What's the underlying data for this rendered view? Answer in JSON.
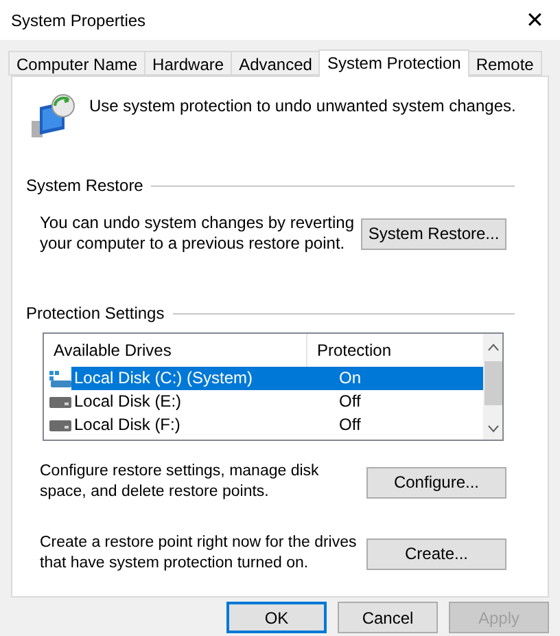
{
  "window": {
    "title": "System Properties",
    "close": "✕"
  },
  "tabs": [
    {
      "label": "Computer Name",
      "selected": false
    },
    {
      "label": "Hardware",
      "selected": false
    },
    {
      "label": "Advanced",
      "selected": false
    },
    {
      "label": "System Protection",
      "selected": true
    },
    {
      "label": "Remote",
      "selected": false
    }
  ],
  "intro": "Use system protection to undo unwanted system changes.",
  "system_restore": {
    "heading": "System Restore",
    "text": "You can undo system changes by reverting your computer to a previous restore point.",
    "button": "System Restore..."
  },
  "protection_settings": {
    "heading": "Protection Settings",
    "columns": [
      "Available Drives",
      "Protection"
    ],
    "drives": [
      {
        "name": "Local Disk (C:) (System)",
        "protection": "On",
        "kind": "system",
        "selected": true
      },
      {
        "name": "Local Disk (E:)",
        "protection": "Off",
        "kind": "disk",
        "selected": false
      },
      {
        "name": "Local Disk (F:)",
        "protection": "Off",
        "kind": "disk",
        "selected": false
      }
    ],
    "actions": [
      {
        "text": "Configure restore settings, manage disk space, and delete restore points.",
        "button": "Configure..."
      },
      {
        "text": "Create a restore point right now for the drives that have system protection turned on.",
        "button": "Create..."
      }
    ]
  },
  "buttons": [
    {
      "label": "OK",
      "default": true,
      "disabled": false
    },
    {
      "label": "Cancel",
      "default": false,
      "disabled": false
    },
    {
      "label": "Apply",
      "default": false,
      "disabled": true
    }
  ]
}
